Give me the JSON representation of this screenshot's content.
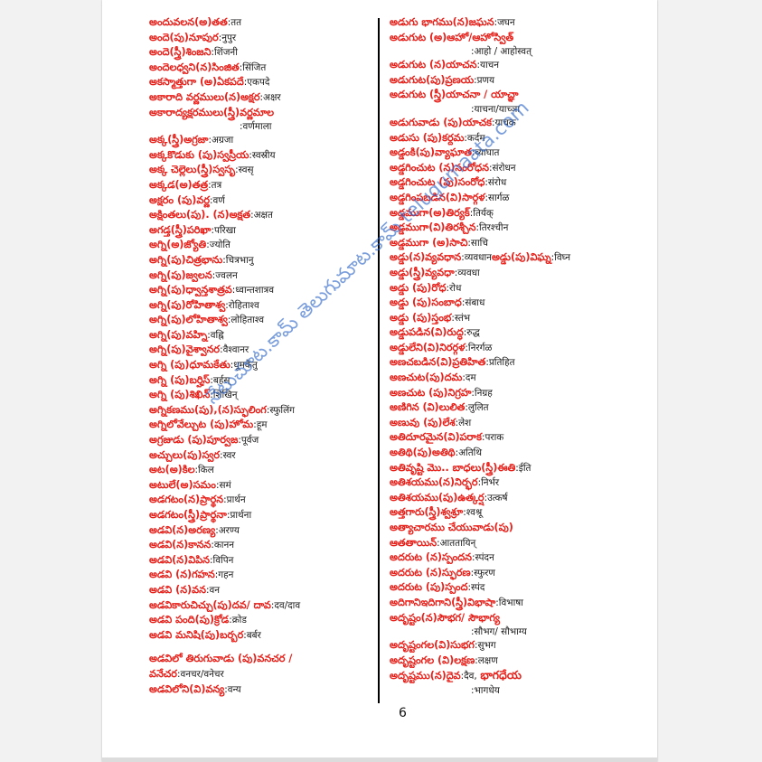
{
  "page_number": "6",
  "watermark": "నేటుచూట.కామ్ తెలుగుమాట.కామ్ telugumaata.com",
  "left_entries": [
    {
      "te": "అందువలన(అ)తత",
      "hi": ":तत"
    },
    {
      "te": "అందె(పు)నూపుర",
      "hi": ":नुपुर"
    },
    {
      "te": "అందె(స్త్రీ)శింజని",
      "hi": ":शिंजनी"
    },
    {
      "te": "అందెలధ్వని(న)సింజిత",
      "hi": ":सिंजित"
    },
    {
      "te": "అకస్మాత్తుగా (అ)ఏకపదే",
      "hi": ":एकपदे"
    },
    {
      "te": "అకారాది వర్ణములు(న)అక్షర",
      "hi": ":अक्षर"
    },
    {
      "te": "అకారాద్యక్షరములు(స్త్రీ)వర్ణమాల",
      "hi": "",
      "cont": ":वर्णमाला"
    },
    {
      "te": "అక్క(స్త్రీ)అగ్రజా",
      "hi": ":अग्रजा"
    },
    {
      "te": "అక్కకొడుకు (పు)స్వస్రీయ",
      "hi": ":स्वस्रीय"
    },
    {
      "te": "అక్క చెల్లెలు(స్త్రీ)స్వసృ",
      "hi": ":स्वसृ"
    },
    {
      "te": "అక్కడ(అ)తత్ర",
      "hi": ":तत्र"
    },
    {
      "te": "అక్షరం (పు)వర్ణ",
      "hi": ":वर्ण"
    },
    {
      "te": "అక్షింతలు(పు). (న)అక్షత",
      "hi": ":अक्षत"
    },
    {
      "te": "అగడ్త(స్త్రీ)పరిఖా",
      "hi": ":परिखा"
    },
    {
      "te": "అగ్ని(అ)జ్యోతి",
      "hi": ":ज्योति"
    },
    {
      "te": "అగ్ని(పు)చిత్రభాను",
      "hi": ":चित्रभानु"
    },
    {
      "te": "అగ్ని(పు)జ్వలన",
      "hi": ":ज्वलन"
    },
    {
      "te": "అగ్ని(పు)ధ్వాన్తశాత్రవ",
      "hi": ":ध्वान्तशात्रव"
    },
    {
      "te": "అగ్ని(పు)రోహితాశ్వ",
      "hi": ":रोहिताश्व"
    },
    {
      "te": "అగ్ని(పు)లోహితాశ్వ",
      "hi": ":लोहिताश्व"
    },
    {
      "te": "అగ్ని(పు)వహ్ని",
      "hi": ":वह्नि"
    },
    {
      "te": "అగ్ని(పు)వైశ్వానర",
      "hi": ":वैश्वानर"
    },
    {
      "te": "అగ్ని (పు)ధూమకేతు",
      "hi": ":धूमकेतु"
    },
    {
      "te": "అగ్ని (పు)బర్హిస్",
      "hi": ":बर्हस्"
    },
    {
      "te": "అగ్ని (పు)శిఖిన్",
      "hi": ":शिखिन्"
    },
    {
      "te": "అగ్నికణము(పు),(న)స్ఫులింగ",
      "hi": ":स्फुलिंग"
    },
    {
      "te": "అగ్నిలోవేల్చుట (పు)హోమ",
      "hi": ":हूम"
    },
    {
      "te": "అగ్రజుడు (పు)పూర్వజ",
      "hi": ":पूर्वज"
    },
    {
      "te": "అచ్చులు(పు)స్వర",
      "hi": ":स्वर"
    },
    {
      "te": "అట(అ)కిల",
      "hi": ":किल"
    },
    {
      "te": "అటులే(అ)సమం",
      "hi": ":समं"
    },
    {
      "te": "అడగటం(న)ప్రార్థన",
      "hi": ":प्रार्थन"
    },
    {
      "te": "అడగటం(స్త్రీ)ప్రార్థనా",
      "hi": ":प्रार्थना"
    },
    {
      "te": "అడవి(న)అరణ్య",
      "hi": ":अरण्य"
    },
    {
      "te": "అడవి(న)కానన",
      "hi": ":कानन"
    },
    {
      "te": "అడవి(న)విపిన",
      "hi": ":विपिन"
    },
    {
      "te": "అడవి (న)గహన",
      "hi": ":गहन"
    },
    {
      "te": "అడవి (న)వన",
      "hi": ":वन"
    },
    {
      "te": "అడవికారుచిచ్చు(పు)దవ/ దావ",
      "hi": ":दव/दाव"
    },
    {
      "te": "అడవి పంది(పు)క్రోడ",
      "hi": ":क्रोड"
    },
    {
      "te": "అడవి మనిషి(పు)బర్బర",
      "hi": ":बर्बर"
    },
    {
      "gap": true
    },
    {
      "te": "అడవిలో తిరుగువాడు (పు)వనచర /",
      "hi": ""
    },
    {
      "te": "వనేచర",
      "hi": ":वनचर/वनेचर"
    },
    {
      "te": "అడవిలోని(వి)వన్య",
      "hi": ":वन्य"
    }
  ],
  "right_entries": [
    {
      "te": "అడుగు భాగము(న)జఘన",
      "hi": ":जघन"
    },
    {
      "te": "అడుగుట (అ)ఆహో/ఆహోస్విత్",
      "hi": "",
      "cont": ":आहो  / आहोस्वत्"
    },
    {
      "te": "అడుగుట (న)యాచన",
      "hi": ":याचन"
    },
    {
      "te": "అడుగుట(పు)ప్రణయ",
      "hi": ":प्रणय"
    },
    {
      "te": "అడుగుట (స్త్రీ)యాచనా / యాచ్ఞా",
      "hi": "",
      "cont": ":याचना/याच्ञा"
    },
    {
      "te": "అడుగువాడు (పు)యాచక",
      "hi": ":याचक"
    },
    {
      "te": "అడుసు (పు)కర్దమ",
      "hi": ":कर्दम"
    },
    {
      "te": "అడ్డంకి(పు)వ్యాఘాత",
      "hi": ":व्याघात"
    },
    {
      "te": "అడ్డగించుట (న)సంరోధన",
      "hi": ":संरोधन"
    },
    {
      "te": "అడ్డగించుట (పు)సంరోధ",
      "hi": ":संरोध"
    },
    {
      "te": "అడ్డగింపబడిన(వి)సార్గళ",
      "hi": ":सार्गळ"
    },
    {
      "te": "అడ్డముగా(అ)తిర్యక్",
      "hi": ":तिर्यक्"
    },
    {
      "te": "అడ్డముగా(వి)తిరశ్చీన",
      "hi": ":तिरश्चीन"
    },
    {
      "te": "అడ్డముగా (అ)సాచి",
      "hi": ":साचि"
    },
    {
      "te": "అడ్డు(న)వ్యవధాన",
      "hi": ":व्यवधान",
      "extra_te": "అడ్డు(పు)విఘ్న",
      "extra_hi": ":विघ्न"
    },
    {
      "te": "అడ్డు(స్త్రీ)వ్యవధా",
      "hi": ":व्यवधा"
    },
    {
      "te": "అడ్డు (పు)రోధ",
      "hi": ":रोध"
    },
    {
      "te": "అడ్డు (పు)సంబాధ",
      "hi": ":संबाध"
    },
    {
      "te": "అడ్డు (పు)స్తంభ",
      "hi": ":स्तंभ"
    },
    {
      "te": "అడ్డుపడిన(వి)రుద్ధ",
      "hi": ":रुद्ध"
    },
    {
      "te": "అడ్డులేని(వి)నిరర్గళ",
      "hi": ":निरर्गळ"
    },
    {
      "te": "అణచబడిన(వి)ప్రతిహిత",
      "hi": ":प्रतिहित"
    },
    {
      "te": "అణచుట(పు)దమ",
      "hi": ":दम"
    },
    {
      "te": "అణచుట (పు)నిగ్రహ",
      "hi": ":निग्रह"
    },
    {
      "te": "అణిగిన (వి)లులిత",
      "hi": ":लुलित"
    },
    {
      "te": "అణువు (పు)లేశ",
      "hi": ":लेश"
    },
    {
      "te": "అతిదూరమైన(వి)పరాక",
      "hi": ":पराक"
    },
    {
      "te": "అతిథి(పు)అతిథి",
      "hi": ":अतिथि"
    },
    {
      "te": "అతివృష్టి మొ.. బాధలు(స్త్రీ)ఈతి",
      "hi": ":ईति"
    },
    {
      "te": "అతిశయము(న)నిర్భర",
      "hi": ":निर्भर"
    },
    {
      "te": "అతిశయము(పు)ఉత్కర్ష",
      "hi": ":उत्कर्ष"
    },
    {
      "te": "అత్తగారు(స్త్రీ)శ్వశ్రూ",
      "hi": ":श्वश्रू"
    },
    {
      "te": "అత్యాచారము చేయువాడు(పు)",
      "hi": ""
    },
    {
      "te": "ఆతతాయిన్",
      "hi": ":आततायिन्"
    },
    {
      "te": "అదరుట (న)స్పందన",
      "hi": ":स्पंदन"
    },
    {
      "te": "అదరుట (న)స్ఫురణ",
      "hi": ":स्फुरण"
    },
    {
      "te": "అదరుట (పు)స్పంద",
      "hi": ":स्पंद"
    },
    {
      "te": "అదిగానిఇదిగాని(స్త్రీ)విభాషా",
      "hi": ":विभाषा"
    },
    {
      "te": "అదృష్టం(న)సౌభగ/ సౌభాగ్య",
      "hi": "",
      "cont": ":सौभग/ सौभाग्य"
    },
    {
      "te": "అదృష్టంగల(వి)సుభగ",
      "hi": ":सुभग"
    },
    {
      "te": "అదృష్టంగల (వి)లక్షణ",
      "hi": ":लक्षण"
    },
    {
      "te": "అదృష్టము(న)దైవ",
      "hi": ":दैव,",
      "big": "భాగధేయ",
      "cont": ":भागधेय"
    }
  ]
}
